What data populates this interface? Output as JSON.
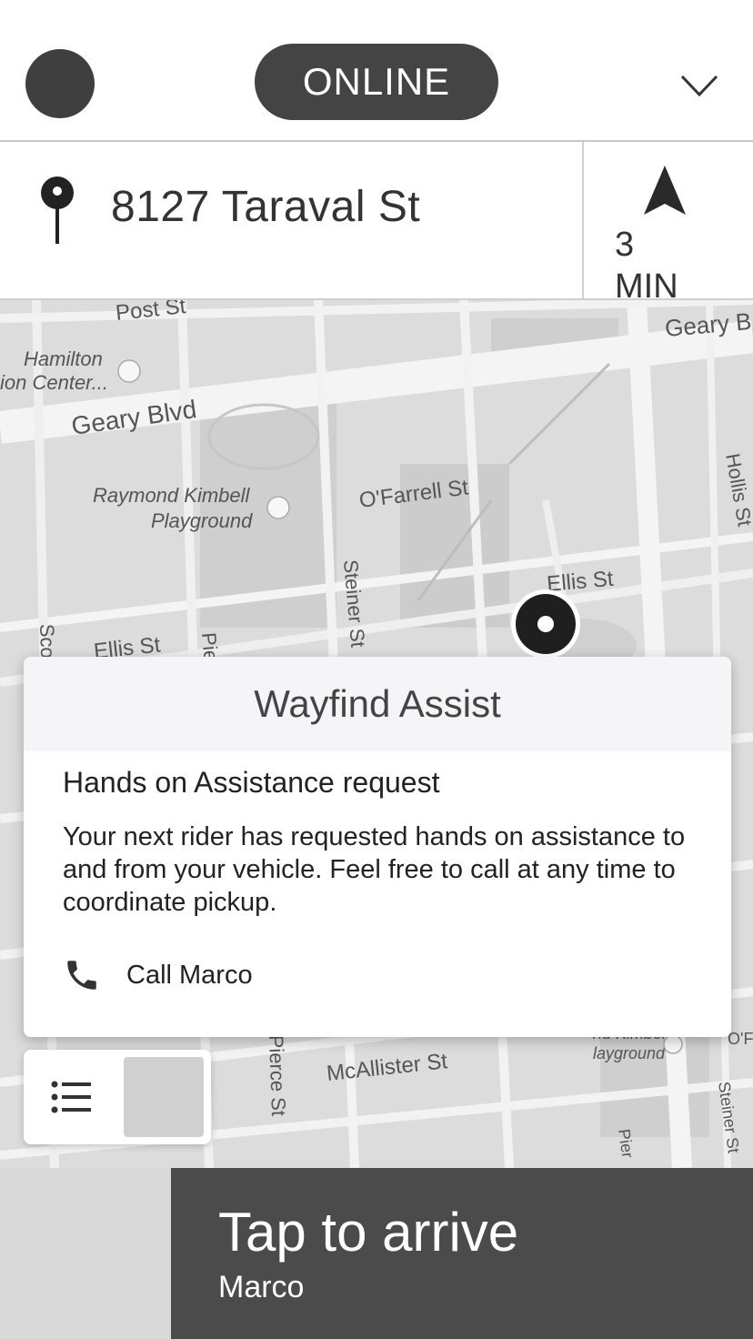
{
  "header": {
    "status_label": "ONLINE"
  },
  "trip": {
    "address": "8127 Taraval St",
    "eta_value": "3",
    "eta_unit": "MIN"
  },
  "map": {
    "labels": {
      "post": "Post St",
      "geary_right": "Geary B",
      "hamilton1": "Hamilton",
      "hamilton2": "ion Center...",
      "geary": "Geary Blvd",
      "raymond1": "Raymond Kimbell",
      "raymond2": "Playground",
      "ofarrell": "O'Farrell St",
      "hollis": "Hollis St",
      "steiner": "Steiner St",
      "ellis_right": "Ellis St",
      "ellis_left": "Ellis St",
      "sco": "Sco",
      "pie": "Pie",
      "pierce": "Pierce St",
      "mcallister": "McAllister St",
      "kimbell1": "nd Kimbell",
      "kimbell2": "layground",
      "ofarrell_small": "O'F",
      "steiner_small": "Steiner St",
      "pier_small": "Pier"
    }
  },
  "card": {
    "title": "Wayfind Assist",
    "heading": "Hands on Assistance request",
    "body": "Your next rider has requested hands on assistance to and from your vehicle. Feel free to call at any time to coordinate pickup.",
    "call_label": "Call Marco"
  },
  "bottom": {
    "title": "Tap to arrive",
    "subtitle": "Marco"
  }
}
